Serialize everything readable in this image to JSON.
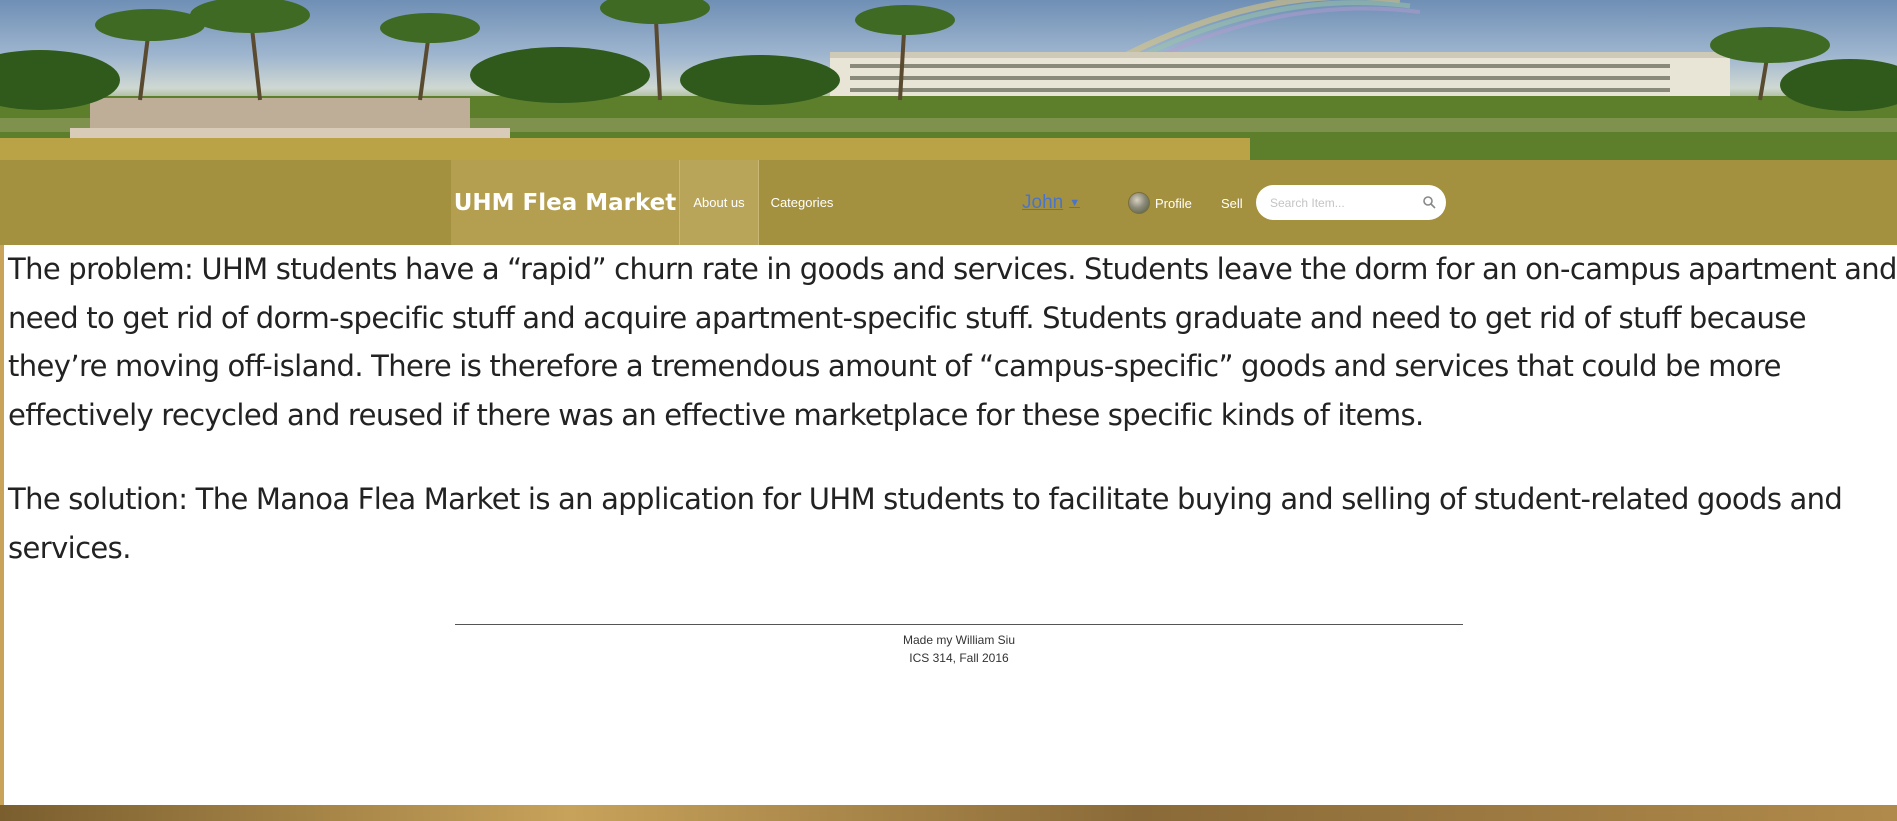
{
  "header": {
    "banner_alt": "campus-banner-image"
  },
  "navbar": {
    "brand": "UHM Flea Market",
    "about_label": "About us",
    "categories_label": "Categories",
    "user_label": "John",
    "user_caret": "▼",
    "profile_label": "Profile",
    "sell_label": "Sell",
    "search_placeholder": "Search Item...",
    "accent_color": "#a4913f"
  },
  "main": {
    "problem_text": "The problem: UHM students have a “rapid” churn rate in goods and services. Students leave the dorm for an on-campus apartment and need to get rid of dorm-specific stuff and acquire apartment-specific stuff. Students graduate and need to get rid of stuff because they’re moving off-island. There is therefore a tremendous amount of “campus-specific” goods and services that could be more effectively recycled and reused if there was an effective marketplace for these specific kinds of items.",
    "solution_text": "The solution: The Manoa Flea Market is an application for UHM students to facilitate buying and selling of student-related goods and services."
  },
  "footer": {
    "line1": "Made my William Siu",
    "line2": "ICS 314, Fall 2016"
  }
}
